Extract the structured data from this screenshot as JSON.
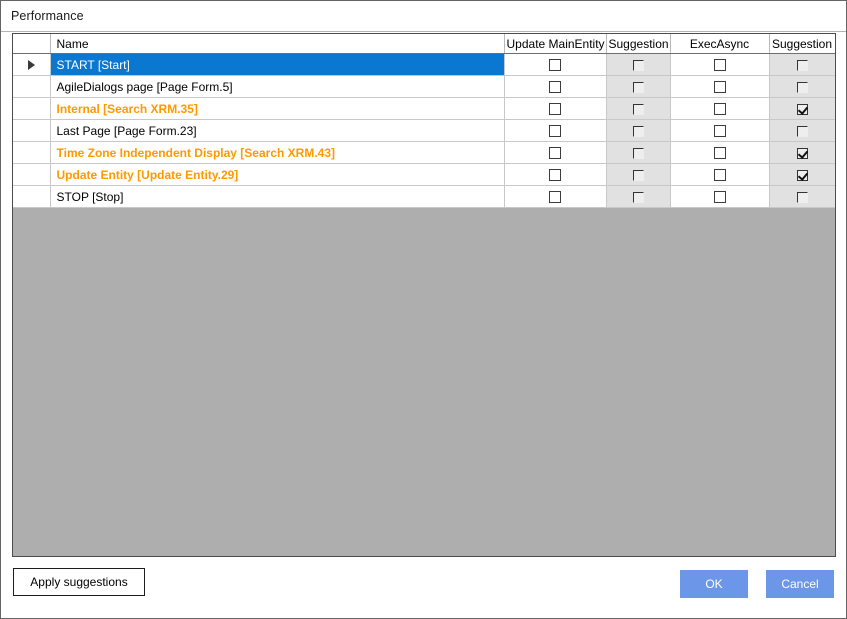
{
  "window": {
    "title": "Performance"
  },
  "grid": {
    "columns": [
      {
        "key": "gutter",
        "label": ""
      },
      {
        "key": "name",
        "label": "Name"
      },
      {
        "key": "update_main_entity",
        "label": "Update MainEntity"
      },
      {
        "key": "suggestion_update",
        "label": "Suggestion"
      },
      {
        "key": "exec_async",
        "label": "ExecAsync"
      },
      {
        "key": "suggestion_exec",
        "label": "Suggestion"
      }
    ],
    "rows": [
      {
        "indicator": "row-selector-arrow",
        "name": "START [Start]",
        "selected": true,
        "accent": false,
        "update_main_entity": false,
        "suggestion_update": false,
        "exec_async": false,
        "suggestion_exec": false
      },
      {
        "indicator": "",
        "name": "AgileDialogs page [Page Form.5]",
        "selected": false,
        "accent": false,
        "update_main_entity": false,
        "suggestion_update": false,
        "exec_async": false,
        "suggestion_exec": false
      },
      {
        "indicator": "",
        "name": "Internal [Search XRM.35]",
        "selected": false,
        "accent": true,
        "update_main_entity": false,
        "suggestion_update": false,
        "exec_async": false,
        "suggestion_exec": true
      },
      {
        "indicator": "",
        "name": "Last Page [Page Form.23]",
        "selected": false,
        "accent": false,
        "update_main_entity": false,
        "suggestion_update": false,
        "exec_async": false,
        "suggestion_exec": false
      },
      {
        "indicator": "",
        "name": "Time Zone Independent Display [Search XRM.43]",
        "selected": false,
        "accent": true,
        "update_main_entity": false,
        "suggestion_update": false,
        "exec_async": false,
        "suggestion_exec": true
      },
      {
        "indicator": "",
        "name": "Update Entity [Update Entity.29]",
        "selected": false,
        "accent": true,
        "update_main_entity": false,
        "suggestion_update": false,
        "exec_async": false,
        "suggestion_exec": true
      },
      {
        "indicator": "",
        "name": "STOP [Stop]",
        "selected": false,
        "accent": false,
        "update_main_entity": false,
        "suggestion_update": false,
        "exec_async": false,
        "suggestion_exec": false
      }
    ]
  },
  "footer": {
    "apply_label": "Apply suggestions",
    "ok_label": "OK",
    "cancel_label": "Cancel"
  },
  "colors": {
    "selection_blue": "#0a78d0",
    "accent_orange": "#ff9900",
    "button_blue": "#6c96e8",
    "grid_empty_gray": "#aeaeae",
    "suggestion_column_gray": "#e1e1e1"
  }
}
